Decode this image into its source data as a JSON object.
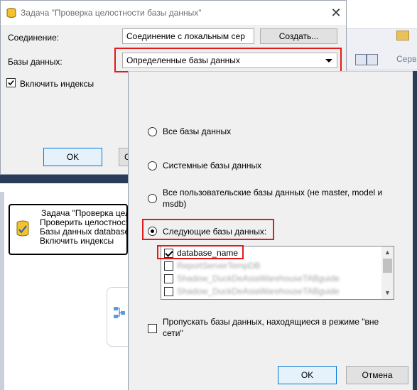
{
  "back_dialog": {
    "title": "Задача \"Проверка целостности базы данных\"",
    "close_glyph": "✕",
    "connection_label": "Соединение:",
    "connection_value": "Соединение с локальным сер",
    "create_button": "Создать...",
    "databases_label": "Базы данных:",
    "databases_value": "Определенные базы данных",
    "include_indexes_label": "Включить индексы",
    "include_indexes_checked": true,
    "ok_button": "OK",
    "cancel_button_partial": "С"
  },
  "database_panel": {
    "options": [
      {
        "label": "Все базы данных",
        "selected": false
      },
      {
        "label": "Системные базы данных",
        "selected": false
      },
      {
        "label": "Все пользовательские базы данных (не master, model и msdb)",
        "selected": false
      },
      {
        "label": "Следующие базы данных:",
        "selected": true
      }
    ],
    "database_list": [
      {
        "name": "database_name",
        "checked": true,
        "obscured": false
      },
      {
        "name": "ReportServerTempDB",
        "checked": false,
        "obscured": true
      },
      {
        "name": "Shadow_DuckDeAsiaWarehouseTABguide",
        "checked": false,
        "obscured": true
      },
      {
        "name": "Shadow_DuckDeAsiaWarehouseTABguide",
        "checked": false,
        "obscured": true
      }
    ],
    "skip_offline_label": "Пропускать базы данных, находящиеся в режиме \"вне сети\"",
    "skip_offline_checked": false,
    "ok_button": "OK",
    "cancel_button": "Отмена"
  },
  "designer": {
    "task_title": "Задача \"Проверка целос",
    "task_line1": "Проверить целостность б",
    "task_line2": "Базы данных database_na",
    "task_line3": "Включить индексы",
    "toolbar_server_label": "Серв"
  },
  "colors": {
    "highlight": "#e21a1a",
    "default_button_border": "#0078d7",
    "dialog_bg": "#f0f0f0"
  }
}
